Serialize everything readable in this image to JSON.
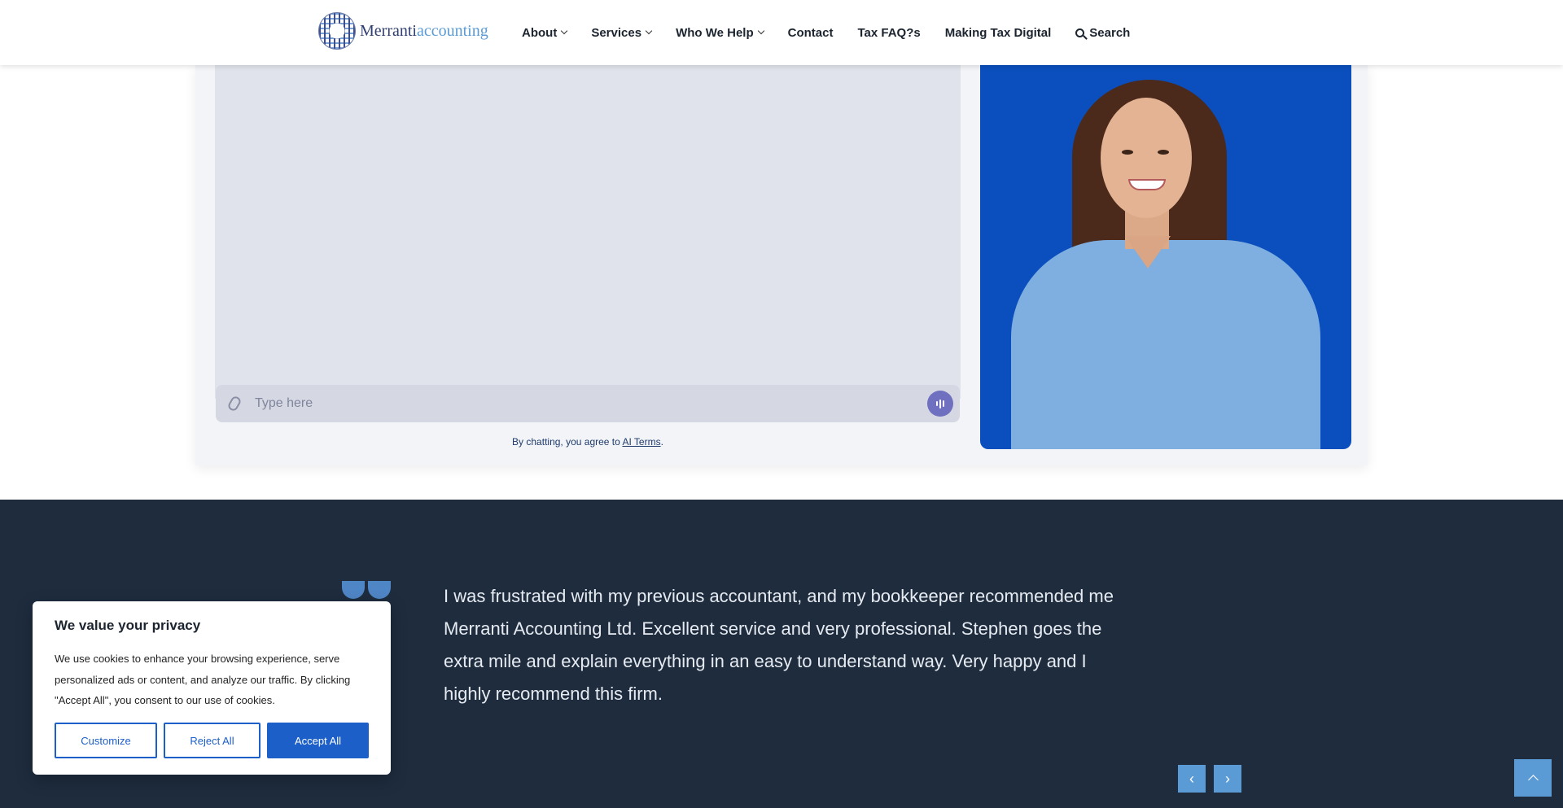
{
  "header": {
    "logo": {
      "part1": "Merranti",
      "part2": "accounting"
    },
    "nav": [
      {
        "label": "About",
        "dropdown": true
      },
      {
        "label": "Services",
        "dropdown": true
      },
      {
        "label": "Who We Help",
        "dropdown": true
      },
      {
        "label": "Contact",
        "dropdown": false
      },
      {
        "label": "Tax FAQ?s",
        "dropdown": false
      },
      {
        "label": "Making Tax Digital",
        "dropdown": false
      }
    ],
    "search_label": "Search"
  },
  "chat": {
    "input_placeholder": "Type here",
    "terms_prefix": "By chatting, you agree to ",
    "terms_link": "AI Terms",
    "terms_suffix": "."
  },
  "testimonial": {
    "quote": "I was frustrated with my previous accountant, and my bookkeeper recommended me Merranti Accounting Ltd. Excellent service and very professional. Stephen goes the extra mile and explain everything in an easy to understand way. Very happy and I highly recommend this firm.",
    "prev_label": "‹",
    "next_label": "›"
  },
  "cookie": {
    "title": "We value your privacy",
    "body": "We use cookies to enhance your browsing experience, serve personalized ads or content, and analyze our traffic. By clicking \"Accept All\", you consent to our use of cookies.",
    "customize": "Customize",
    "reject": "Reject All",
    "accept": "Accept All"
  },
  "colors": {
    "brand_dark": "#2f3e6e",
    "brand_light": "#5b9bd5",
    "testimonial_bg": "#1e2c3e",
    "cookie_button": "#1d5fc9",
    "photo_bg": "#0a4fbd"
  }
}
